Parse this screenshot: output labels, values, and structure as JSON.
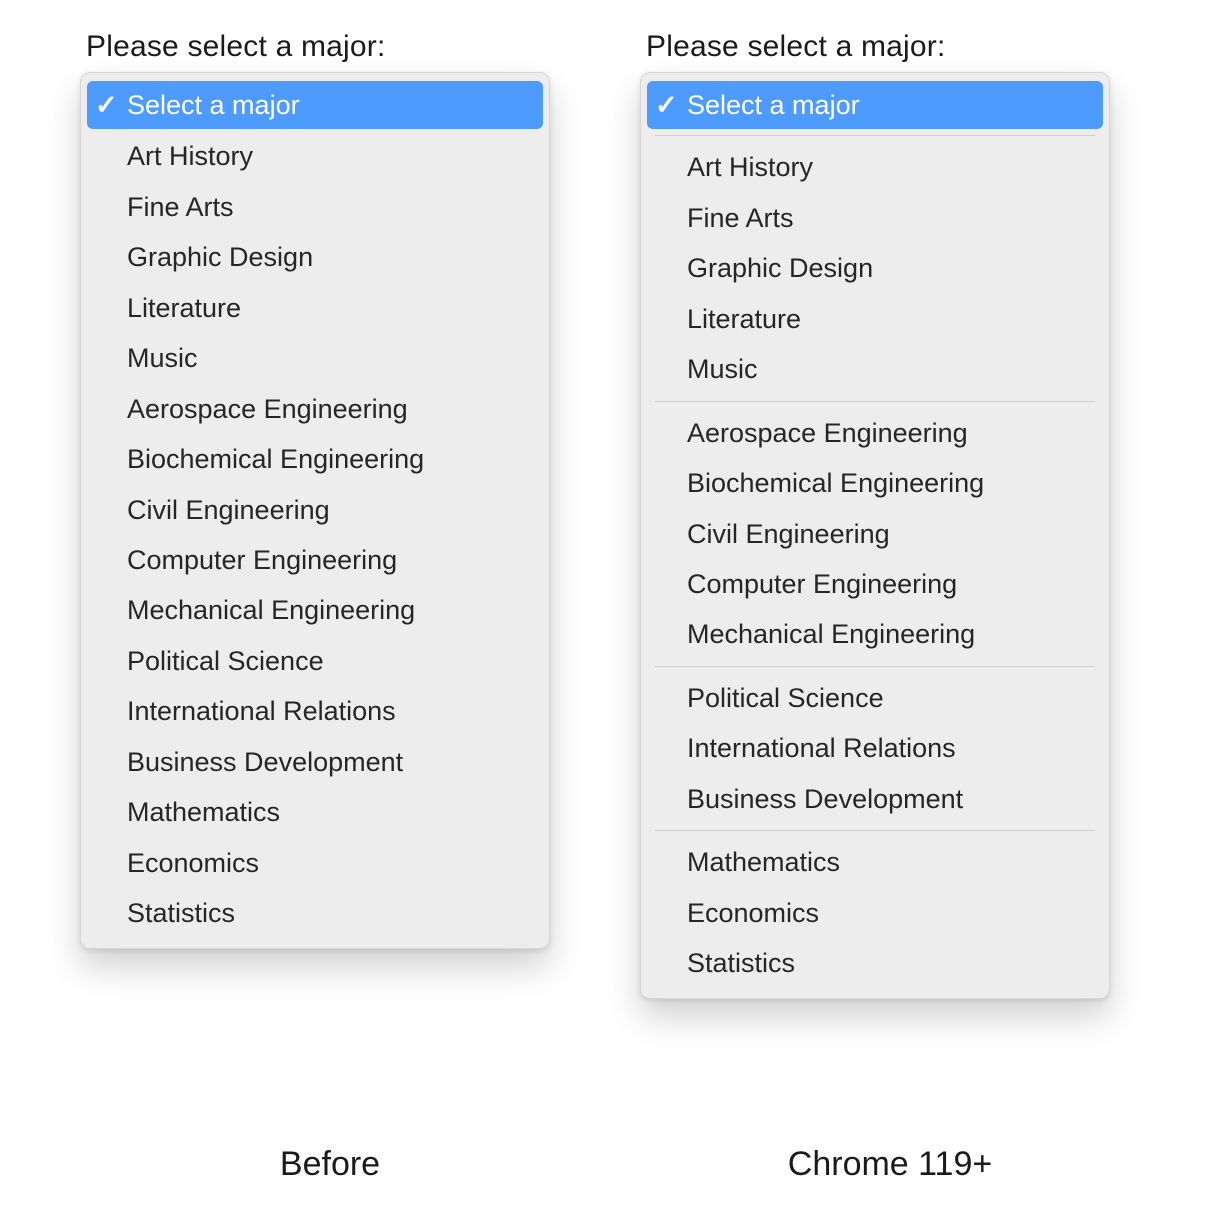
{
  "label_text": "Please select a major:",
  "selected_option": "Select a major",
  "check_glyph": "✓",
  "before": {
    "caption": "Before",
    "options": [
      "Art History",
      "Fine Arts",
      "Graphic Design",
      "Literature",
      "Music",
      "Aerospace Engineering",
      "Biochemical Engineering",
      "Civil Engineering",
      "Computer Engineering",
      "Mechanical Engineering",
      "Political Science",
      "International Relations",
      "Business Development",
      "Mathematics",
      "Economics",
      "Statistics"
    ]
  },
  "after": {
    "caption": "Chrome 119+",
    "groups": [
      [
        "Art History",
        "Fine Arts",
        "Graphic Design",
        "Literature",
        "Music"
      ],
      [
        "Aerospace Engineering",
        "Biochemical Engineering",
        "Civil Engineering",
        "Computer Engineering",
        "Mechanical Engineering"
      ],
      [
        "Political Science",
        "International Relations",
        "Business Development"
      ],
      [
        "Mathematics",
        "Economics",
        "Statistics"
      ]
    ]
  },
  "colors": {
    "highlight": "#4e9bff",
    "menu_bg": "#ededed",
    "text": "#262626"
  }
}
